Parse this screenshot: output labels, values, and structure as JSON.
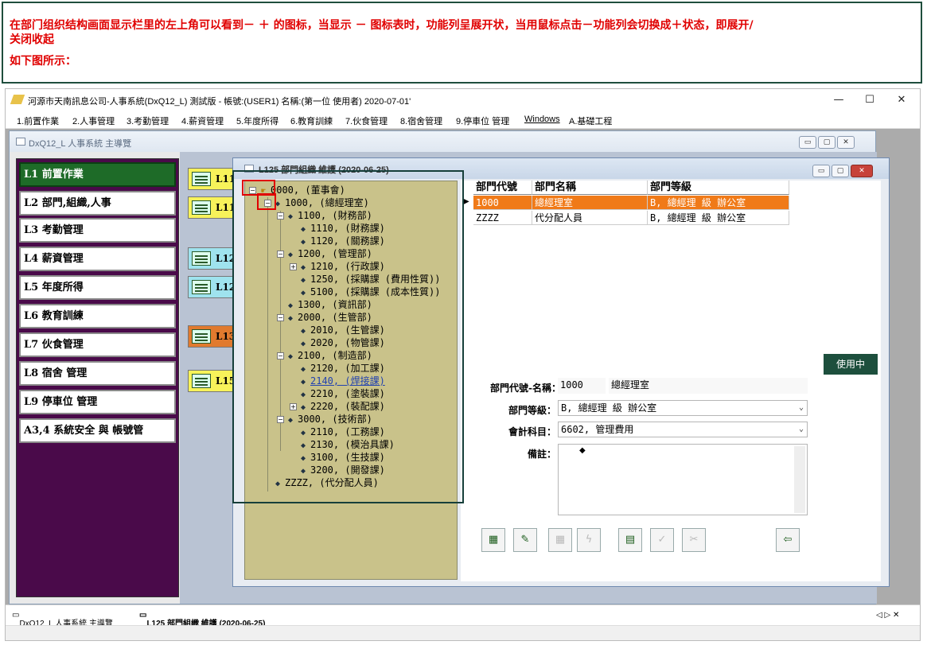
{
  "instruction": {
    "line1": "在部门组织结构画面显示栏里的左上角可以看到－ ＋ 的图标，当显示 － 图标表时，功能列呈展开状，当用鼠标点击－功能列会切换成＋状态，即展开/",
    "line2": "关闭收起",
    "line3": "如下图所示："
  },
  "app": {
    "title": "河源市天南訊息公司-人事系統(DxQ12_L) 測試版 - 帳號:(USER1) 名稱:(第一位 使用者) 2020-07-01'",
    "win_controls": [
      "—",
      "☐",
      "✕"
    ],
    "menu": [
      "1.前置作業",
      "2.人事管理",
      "3.考勤管理",
      "4.薪資管理",
      "5.年度所得",
      "6.教育訓練",
      "7.伙食管理",
      "8.宿舍管理",
      "9.停車位 管理",
      "Windows",
      "A.基礎工程"
    ]
  },
  "main_window": {
    "title": "DxQ12_L 人事系統 主導覽",
    "controls": [
      "▭",
      "▢",
      "✕"
    ],
    "nav": [
      "L1  前置作業",
      "L2  部門,組織,人事",
      "L3  考勤管理",
      "L4  薪資管理",
      "L5  年度所得",
      "L6  教育訓練",
      "L7  伙食管理",
      "L8  宿舍 管理",
      "L9  停車位  管理",
      "A3,4  系統安全  與  帳號管"
    ],
    "sub_buttons": [
      "L11",
      "L11",
      "L12",
      "L12",
      "L13",
      "L15"
    ]
  },
  "dialog": {
    "title": "L125 部門組織 維護 (2020-06-25)",
    "controls": [
      "▭",
      "▢",
      "✕"
    ],
    "tree": [
      "0000, (董事會)",
      "1000, (總經理室)",
      "1100, (財務部)",
      "1110, (財務課)",
      "1120, (關務課)",
      "1200, (管理部)",
      "1210, (行政課)",
      "1250, (採購課 (費用性質))",
      "5100, (採購課 (成本性質))",
      "1300, (資訊部)",
      "2000, (生管部)",
      "2010, (生管課)",
      "2020, (物管課)",
      "2100, (制造部)",
      "2120, (加工課)",
      "2140, (焊接課)",
      "2210, (塗裝課)",
      "2220, (裝配課)",
      "3000, (技術部)",
      "2110, (工務課)",
      "2130, (模治具課)",
      "3100, (生技課)",
      "3200, (開發課)",
      "ZZZZ, (代分配人員)"
    ],
    "grid": {
      "headers": [
        "部門代號",
        "部門名稱",
        "部門等級"
      ],
      "rows": [
        [
          "1000",
          "總經理室",
          "B, 總經理 級 辦公室"
        ],
        [
          "ZZZZ",
          "代分配人員",
          "B, 總經理 級 辦公室"
        ]
      ]
    },
    "form": {
      "status": "使用中",
      "code_name_label": "部門代號-名稱：",
      "code": "1000",
      "name": "總經理室",
      "level_label": "部門等級：",
      "level": "B, 總經理 級 辦公室",
      "account_label": "會計科目：",
      "account": "6602, 管理費用",
      "note_label": "備註："
    }
  },
  "taskbar": {
    "items": [
      "DxQ12_L 人事系統 主導覽",
      "L125 部門組織 維護 (2020-06-25)"
    ],
    "arrows": "◁ ▷ ✕"
  }
}
